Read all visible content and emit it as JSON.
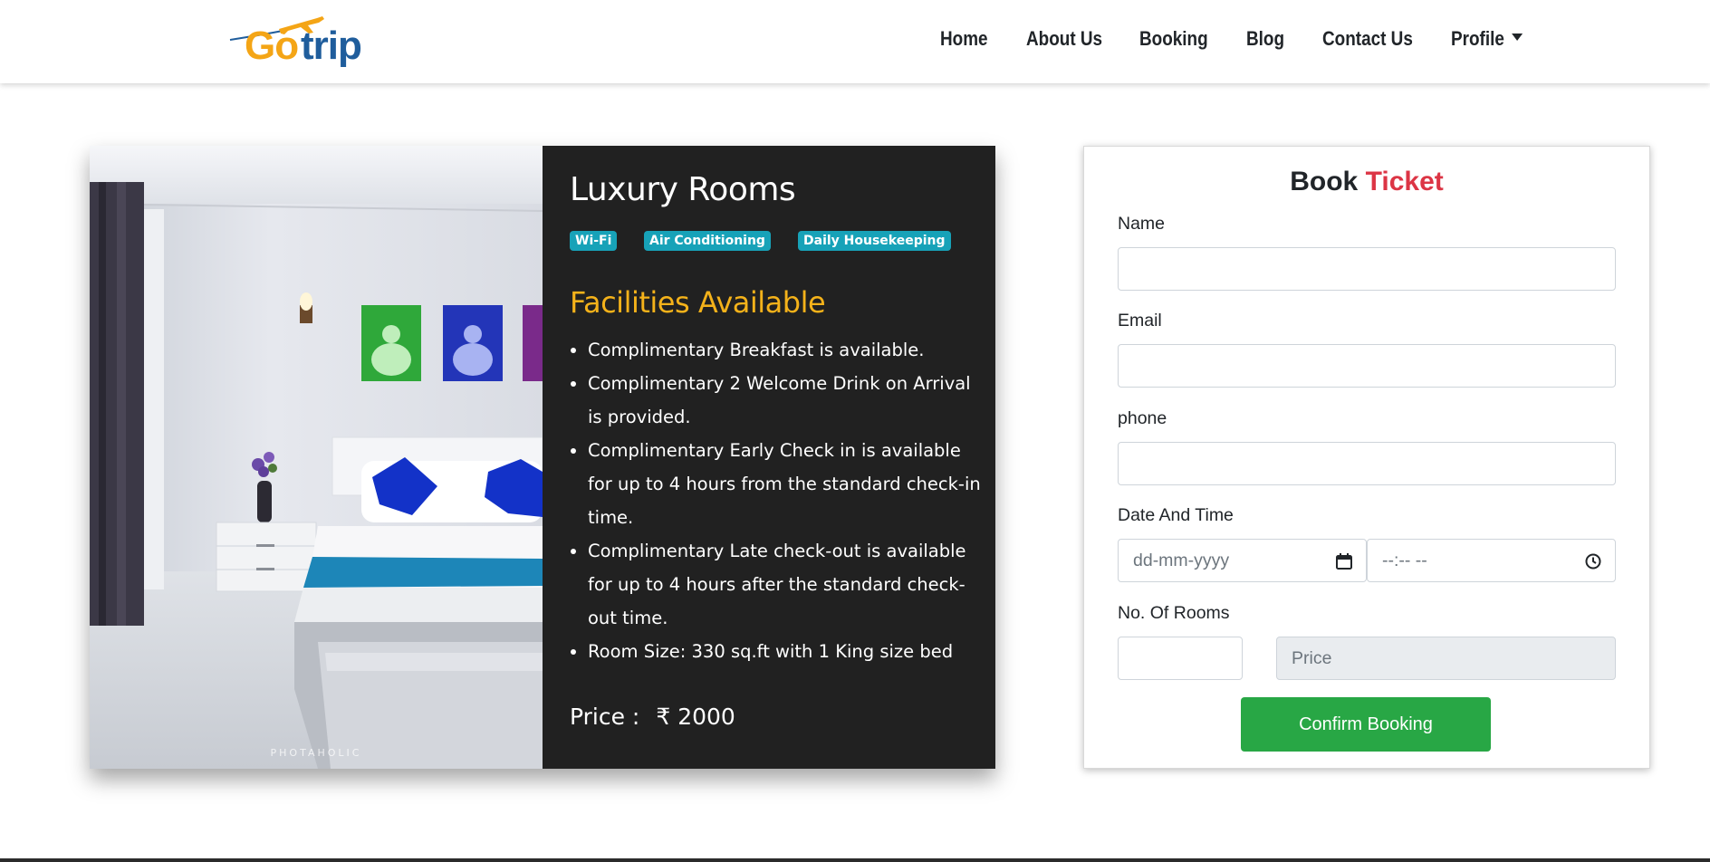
{
  "navbar": {
    "logo": {
      "go": "Go",
      "trip": "trip",
      "icon": "airplane-icon"
    },
    "items": [
      {
        "label": "Home"
      },
      {
        "label": "About Us"
      },
      {
        "label": "Booking"
      },
      {
        "label": "Blog"
      },
      {
        "label": "Contact Us"
      },
      {
        "label": "Profile",
        "icon": "caret-down-icon"
      }
    ]
  },
  "room": {
    "title": "Luxury Rooms",
    "badges": [
      "Wi-Fi",
      "Air Conditioning",
      "Daily Housekeeping"
    ],
    "facilities_title": "Facilities Available",
    "facilities": [
      "Complimentary Breakfast is available.",
      "Complimentary 2 Welcome Drink on Arrival is provided.",
      "Complimentary Early Check in is available for up to 4 hours from the standard check-in time.",
      "Complimentary Late check-out is available for up to 4 hours after the standard check-out time.",
      "Room Size: 330 sq.ft with 1 King size bed"
    ],
    "price_label": "Price :",
    "price_value": "₹ 2000",
    "image_watermark": "PHOTAHOLIC"
  },
  "booking": {
    "title_part1": "Book",
    "title_part2": "Ticket",
    "labels": {
      "name": "Name",
      "email": "Email",
      "phone": "phone",
      "datetime": "Date And Time",
      "rooms": "No. Of Rooms"
    },
    "placeholders": {
      "date": "dd-mm-yyyy",
      "time": "--:-- --",
      "price": "Price"
    },
    "confirm_label": "Confirm Booking"
  },
  "colors": {
    "accent_red": "#dc3545",
    "badge_teal": "#17a2b8",
    "facility_gold": "#f4b21a",
    "confirm_green": "#28a745",
    "logo_orange": "#f4a516",
    "logo_blue": "#1f5d9c"
  }
}
